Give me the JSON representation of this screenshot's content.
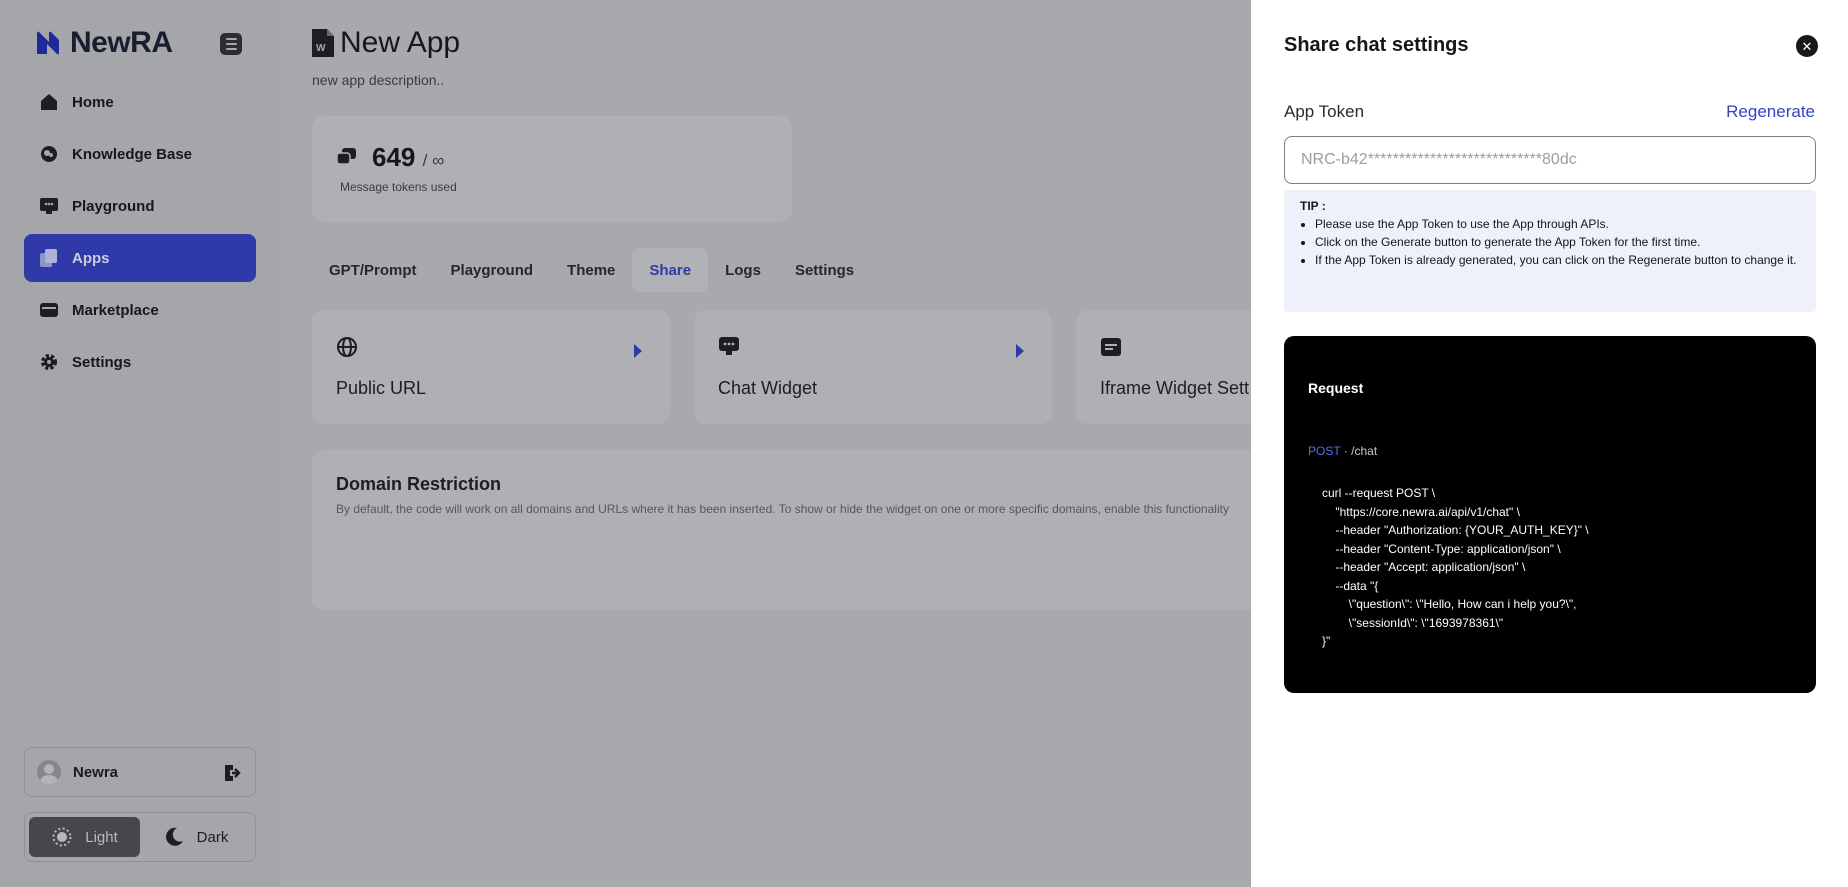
{
  "sidebar": {
    "brand": "NewRA",
    "items": [
      {
        "label": "Home",
        "icon": "home-icon"
      },
      {
        "label": "Knowledge Base",
        "icon": "brain-icon"
      },
      {
        "label": "Playground",
        "icon": "chat-monitor-icon"
      },
      {
        "label": "Apps",
        "icon": "apps-icon",
        "active": true
      },
      {
        "label": "Marketplace",
        "icon": "store-icon"
      },
      {
        "label": "Settings",
        "icon": "gear-icon"
      }
    ],
    "user": {
      "name": "Newra"
    },
    "theme": {
      "light": "Light",
      "dark": "Dark",
      "selected": "Light"
    }
  },
  "main": {
    "title": "New App",
    "description": "new app description..",
    "stats": {
      "value": "649",
      "limit": "/ ∞",
      "label": "Message tokens used"
    },
    "tabs": [
      "GPT/Prompt",
      "Playground",
      "Theme",
      "Share",
      "Logs",
      "Settings"
    ],
    "active_tab": "Share",
    "share_options": [
      {
        "label": "Public URL",
        "icon": "globe-icon"
      },
      {
        "label": "Chat Widget",
        "icon": "chat-widget-icon"
      },
      {
        "label": "Iframe Widget Sett",
        "icon": "iframe-icon"
      }
    ],
    "domain_restriction": {
      "title": "Domain Restriction",
      "description": "By default, the code will work on all domains and URLs where it has been inserted. To show or hide the widget on one or more specific domains, enable this functionality"
    }
  },
  "drawer": {
    "title": "Share chat settings",
    "token_label": "App Token",
    "regenerate_label": "Regenerate",
    "token_placeholder": "NRC-b42****************************80dc",
    "tip": {
      "title": "TIP :",
      "items": [
        "Please use the App Token to use the App through APIs.",
        "Click on the Generate button to generate the App Token for the first time.",
        "If the App Token is already generated, you can click on the Regenerate button to change it."
      ]
    },
    "request": {
      "heading": "Request",
      "method": "POST",
      "path": " · /chat",
      "code": "curl --request POST \\\n    \"https://core.newra.ai/api/v1/chat\" \\\n    --header \"Authorization: {YOUR_AUTH_KEY}\" \\\n    --header \"Content-Type: application/json\" \\\n    --header \"Accept: application/json\" \\\n    --data \"{\n        \\\"question\\\": \\\"Hello, How can i help you?\\\",\n        \\\"sessionId\\\": \\\"1693978361\\\"\n}\""
    }
  },
  "colors": {
    "accent": "#2f3aa8",
    "link": "#3343c7",
    "overlay": "#a7a9ad"
  }
}
